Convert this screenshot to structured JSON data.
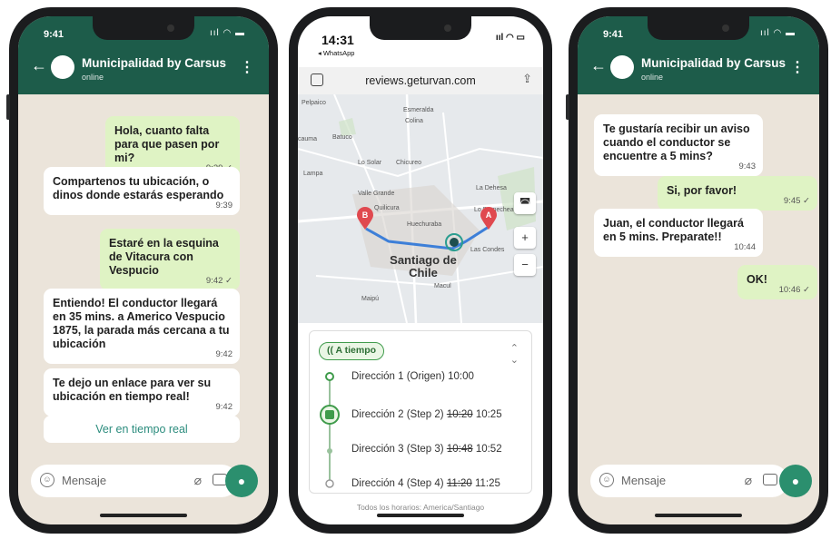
{
  "phone_left": {
    "status_time": "9:41",
    "contact_name": "Municipalidad by Carsus",
    "contact_status": "online",
    "messages": [
      {
        "dir": "out",
        "text": "Hola, cuanto falta para que pasen por mi?",
        "time": "9:39 ✓"
      },
      {
        "dir": "in",
        "text": "Compartenos tu ubicación, o dinos donde estarás esperando",
        "time": "9:39"
      },
      {
        "dir": "out",
        "text": "Estaré en la esquina de Vitacura con Vespucio",
        "time": "9:42 ✓"
      },
      {
        "dir": "in",
        "text": "Entiendo! El conductor llegará en 35 mins. a Americo Vespucio 1875, la parada más cercana a tu ubicación",
        "time": "9:42"
      },
      {
        "dir": "in",
        "text": "Te dejo un enlace para ver su ubicación en tiempo real!",
        "time": "9:42"
      }
    ],
    "link_button": "Ver en tiempo real",
    "input_placeholder": "Mensaje"
  },
  "phone_middle": {
    "status_time": "14:31",
    "back_label": "◂ WhatsApp",
    "url": "reviews.geturvan.com",
    "map": {
      "labels": [
        "Pelpaico",
        "Esmeralda",
        "Colina",
        "cauma",
        "Batuco",
        "Lo Solar",
        "Chicureo",
        "Lampa",
        "La Dehesa",
        "Valle Grande",
        "Quilicura",
        "Huechuraba",
        "Lo Barnechea",
        "Las Condes",
        "Macul",
        "Maipú"
      ],
      "city": "Santiago de Chile",
      "marker_a": "A",
      "marker_b": "B",
      "zoom_in": "+",
      "zoom_out": "−"
    },
    "status_badge": "A tiempo",
    "stops": [
      {
        "label": "Dirección 1 (Origen)",
        "old": "",
        "time": "10:00"
      },
      {
        "label": "Dirección 2 (Step 2)",
        "old": "10:20",
        "time": "10:25"
      },
      {
        "label": "Dirección 3 (Step 3)",
        "old": "10:48",
        "time": "10:52"
      },
      {
        "label": "Dirección 4 (Step 4)",
        "old": "11:20",
        "time": "11:25"
      }
    ],
    "timezone_note": "Todos los horarios: America/Santiago"
  },
  "phone_right": {
    "status_time": "9:41",
    "contact_name": "Municipalidad by Carsus",
    "contact_status": "online",
    "messages": [
      {
        "dir": "in",
        "text": "Te gustaría recibir un aviso cuando el conductor se encuentre a 5 mins?",
        "time": "9:43"
      },
      {
        "dir": "out",
        "text": "Si, por favor!",
        "time": "9:45 ✓"
      },
      {
        "dir": "in",
        "text": "Juan, el conductor llegará en 5 mins. Preparate!!",
        "time": "10:44"
      },
      {
        "dir": "out",
        "text": "OK!",
        "time": "10:46 ✓"
      }
    ],
    "input_placeholder": "Mensaje"
  },
  "colors": {
    "wa_green": "#1d5c4a",
    "bubble_out": "#dff3c4",
    "route_blue": "#3d7fd8",
    "marker_red": "#e0494f",
    "status_green": "#3f9b4b"
  }
}
